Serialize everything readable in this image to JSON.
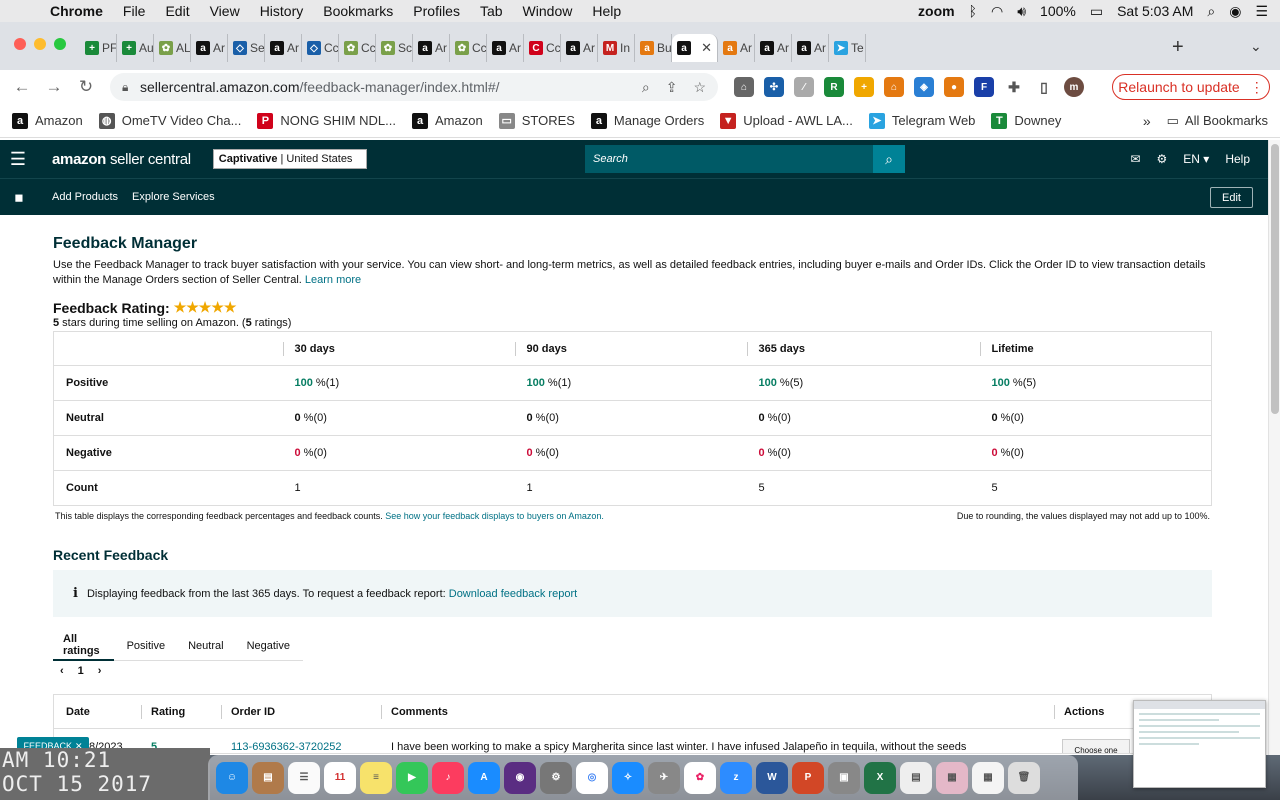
{
  "menubar": {
    "app": "Chrome",
    "items": [
      "File",
      "Edit",
      "View",
      "History",
      "Bookmarks",
      "Profiles",
      "Tab",
      "Window",
      "Help"
    ],
    "zoom": "zoom",
    "battery": "100%",
    "clock": "Sat 5:03 AM"
  },
  "tabs": [
    {
      "label": "PF",
      "color": "#1a8a3a",
      "glyph": "+"
    },
    {
      "label": "Au",
      "color": "#1a8a3a",
      "glyph": "+"
    },
    {
      "label": "AL",
      "color": "#7aa04a",
      "glyph": "✿"
    },
    {
      "label": "Ar",
      "color": "#111111",
      "glyph": "a"
    },
    {
      "label": "Se",
      "color": "#1a5fa8",
      "glyph": "◇"
    },
    {
      "label": "Ar",
      "color": "#111111",
      "glyph": "a"
    },
    {
      "label": "Cc",
      "color": "#1a5fa8",
      "glyph": "◇"
    },
    {
      "label": "Cc",
      "color": "#7aa04a",
      "glyph": "✿"
    },
    {
      "label": "Sc",
      "color": "#7aa04a",
      "glyph": "✿"
    },
    {
      "label": "Ar",
      "color": "#111111",
      "glyph": "a"
    },
    {
      "label": "Cc",
      "color": "#7aa04a",
      "glyph": "✿"
    },
    {
      "label": "Ar",
      "color": "#111111",
      "glyph": "a"
    },
    {
      "label": "Cc",
      "color": "#d0021b",
      "glyph": "C"
    },
    {
      "label": "Ar",
      "color": "#111111",
      "glyph": "a"
    },
    {
      "label": "In",
      "color": "#c5221f",
      "glyph": "M"
    },
    {
      "label": "Bu",
      "color": "#e47911",
      "glyph": "a"
    },
    {
      "label": "",
      "color": "#111111",
      "glyph": "a",
      "active": true
    },
    {
      "label": "Ar",
      "color": "#e47911",
      "glyph": "a"
    },
    {
      "label": "Ar",
      "color": "#111111",
      "glyph": "a"
    },
    {
      "label": "Ar",
      "color": "#111111",
      "glyph": "a"
    },
    {
      "label": "Te",
      "color": "#2aa3e0",
      "glyph": "➤"
    }
  ],
  "address": {
    "domain": "sellercentral.amazon.com",
    "path": "/feedback-manager/index.html#/",
    "relaunch": "Relaunch to update",
    "profile": "m"
  },
  "bookmarks": [
    {
      "label": "Amazon",
      "color": "#111111",
      "glyph": "a"
    },
    {
      "label": "OmeTV Video Cha...",
      "color": "#555555",
      "glyph": "◍"
    },
    {
      "label": "NONG SHIM NDL...",
      "color": "#d0021b",
      "glyph": "P"
    },
    {
      "label": "Amazon",
      "color": "#111111",
      "glyph": "a"
    },
    {
      "label": "STORES",
      "color": "#888888",
      "glyph": "▭"
    },
    {
      "label": "Manage Orders",
      "color": "#111111",
      "glyph": "a"
    },
    {
      "label": "Upload - AWL LA...",
      "color": "#c5221f",
      "glyph": "▼"
    },
    {
      "label": "Telegram Web",
      "color": "#2aa3e0",
      "glyph": "➤"
    },
    {
      "label": "Downey",
      "color": "#1a8a3a",
      "glyph": "T"
    }
  ],
  "bookmarks_all": "All Bookmarks",
  "header": {
    "logo_main": "amazon",
    "logo_sub": "seller central",
    "account_bold": "Captivative",
    "account_region": "| United States",
    "search_placeholder": "Search",
    "lang": "EN",
    "help": "Help"
  },
  "subnav": {
    "add_products": "Add Products",
    "explore": "Explore Services",
    "edit": "Edit"
  },
  "page": {
    "title": "Feedback Manager",
    "intro": "Use the Feedback Manager to track buyer satisfaction with your service. You can view short- and long-term metrics, as well as detailed feedback entries, including buyer e-mails and Order IDs. Click the Order ID to view transaction details within the Manage Orders section of Seller Central.",
    "learn_more": "Learn more",
    "rating_title": "Feedback Rating:",
    "stars": "★★★★★",
    "rating_stars_value": "5",
    "rating_sub_mid": " stars during time selling on Amazon. (",
    "rating_count": "5",
    "rating_sub_end": " ratings)"
  },
  "feedback_table": {
    "headers": [
      "30 days",
      "90 days",
      "365 days",
      "Lifetime"
    ],
    "positive": {
      "label": "Positive",
      "cells": [
        [
          "100",
          " %(1)"
        ],
        [
          "100",
          " %(1)"
        ],
        [
          "100",
          " %(5)"
        ],
        [
          "100",
          " %(5)"
        ]
      ]
    },
    "neutral": {
      "label": "Neutral",
      "cells": [
        [
          "0",
          " %(0)"
        ],
        [
          "0",
          " %(0)"
        ],
        [
          "0",
          " %(0)"
        ],
        [
          "0",
          " %(0)"
        ]
      ]
    },
    "negative": {
      "label": "Negative",
      "cells": [
        [
          "0",
          " %(0)"
        ],
        [
          "0",
          " %(0)"
        ],
        [
          "0",
          " %(0)"
        ],
        [
          "0",
          " %(0)"
        ]
      ]
    },
    "count": {
      "label": "Count",
      "cells": [
        "1",
        "1",
        "5",
        "5"
      ]
    },
    "note_left": "This table displays the corresponding feedback percentages and feedback counts.",
    "note_link": "See how your feedback displays to buyers on Amazon.",
    "note_right": "Due to rounding, the values displayed may not add up to 100%."
  },
  "recent": {
    "title": "Recent Feedback",
    "info_text": "Displaying feedback from the last 365 days. To request a feedback report:",
    "info_link": "Download feedback report",
    "tabs": [
      "All ratings",
      "Positive",
      "Neutral",
      "Negative"
    ],
    "page": "1",
    "columns": [
      "Date",
      "Rating",
      "Order ID",
      "Comments",
      "Actions"
    ],
    "row": {
      "date": "8/2023",
      "rating": "5",
      "order_id": "113-6936362-3720252",
      "comment": "I have been working to make a spicy Margherita since last winter. I have infused Jalapeño in tequila, without the seeds",
      "action": "Choose one"
    }
  },
  "feedback_tab": "FEEDBACK",
  "desktop_clock": [
    "AM 10:21",
    "OCT 15 2017"
  ]
}
